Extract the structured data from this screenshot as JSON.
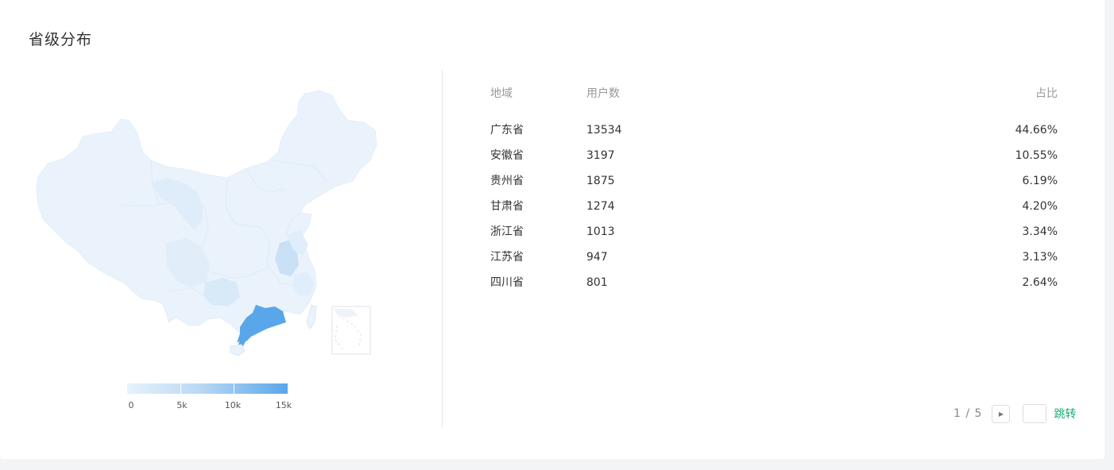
{
  "section": {
    "title": "省级分布"
  },
  "table": {
    "headers": {
      "region": "地域",
      "users": "用户数",
      "ratio": "占比"
    },
    "rows": [
      {
        "region": "广东省",
        "users": "13534",
        "ratio": "44.66%"
      },
      {
        "region": "安徽省",
        "users": "3197",
        "ratio": "10.55%"
      },
      {
        "region": "贵州省",
        "users": "1875",
        "ratio": "6.19%"
      },
      {
        "region": "甘肃省",
        "users": "1274",
        "ratio": "4.20%"
      },
      {
        "region": "浙江省",
        "users": "1013",
        "ratio": "3.34%"
      },
      {
        "region": "江苏省",
        "users": "947",
        "ratio": "3.13%"
      },
      {
        "region": "四川省",
        "users": "801",
        "ratio": "2.64%"
      }
    ]
  },
  "legend": {
    "ticks": [
      "0",
      "5k",
      "10k",
      "15k"
    ],
    "min": 0,
    "max": 15000
  },
  "pager": {
    "indicator": "1 / 5",
    "next_icon": "caret-right-icon",
    "jump_value": "",
    "jump_label": "跳转"
  },
  "colors": {
    "map_base": "#eaf3fc",
    "map_light": "#e1eefa",
    "map_mid": "#d2e6f8",
    "map_highlight": "#5aa6ea",
    "accent_green": "#1aad6f"
  }
}
